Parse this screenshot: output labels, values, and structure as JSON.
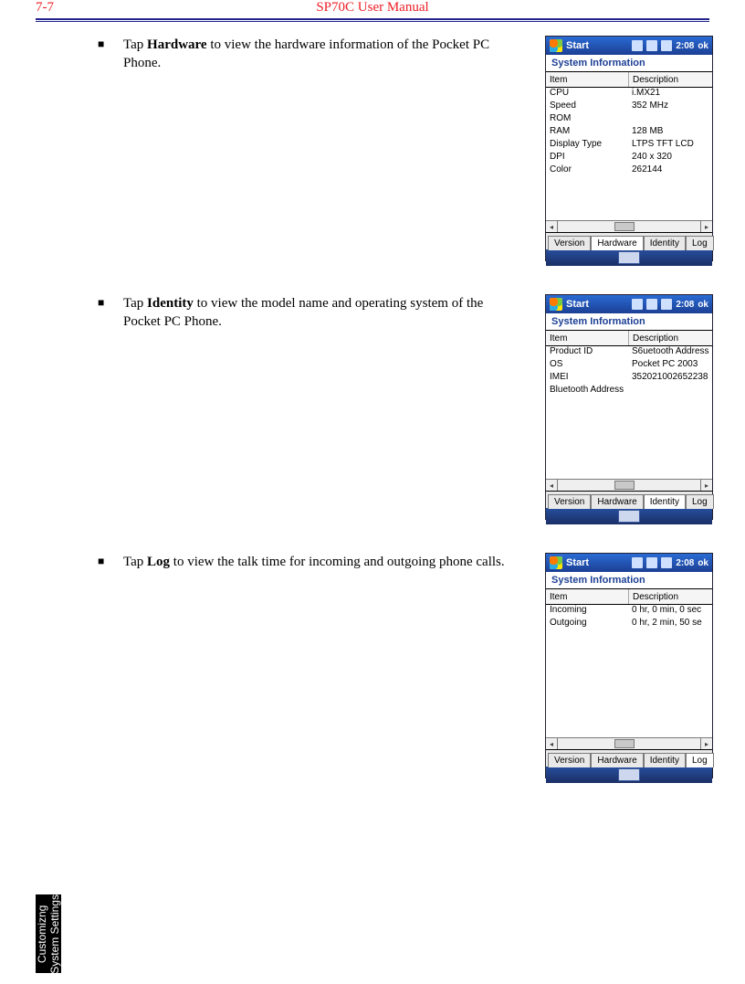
{
  "header": {
    "page_num": "7-7",
    "title": "SP70C User Manual"
  },
  "sidetab": {
    "line1": "Customizng",
    "line2": "System Settings"
  },
  "status_bar": {
    "start": "Start",
    "time": "2:08",
    "ok": "ok"
  },
  "window_title": "System Information",
  "columns": {
    "c1": "Item",
    "c2": "Description"
  },
  "tabs": [
    "Version",
    "Hardware",
    "Identity",
    "Log"
  ],
  "sections": [
    {
      "para_pre": "Tap ",
      "para_b": "Hardware",
      "para_post": " to view the hardware information of the Pocket PC Phone.",
      "active_tab": "Hardware",
      "rows": [
        {
          "c1": "CPU",
          "c2": "i.MX21"
        },
        {
          "c1": "Speed",
          "c2": "352 MHz"
        },
        {
          "c1": "ROM",
          "c2": ""
        },
        {
          "c1": "RAM",
          "c2": "128 MB"
        },
        {
          "c1": "Display Type",
          "c2": "LTPS TFT LCD"
        },
        {
          "c1": "DPI",
          "c2": "240 x 320"
        },
        {
          "c1": "Color",
          "c2": "262144"
        }
      ]
    },
    {
      "para_pre": "Tap ",
      "para_b": "Identity",
      "para_post": " to view the model name and operating system of the Pocket PC Phone.",
      "active_tab": "Identity",
      "rows": [
        {
          "c1": "Product ID",
          "c2": "S6uetooth Address"
        },
        {
          "c1": "OS",
          "c2": "Pocket PC 2003"
        },
        {
          "c1": "IMEI",
          "c2": "352021002652238"
        },
        {
          "c1": "Bluetooth Address",
          "c2": ""
        }
      ]
    },
    {
      "para_pre": "Tap ",
      "para_b": "Log",
      "para_post": " to view the talk time for incoming and outgoing phone calls.",
      "active_tab": "Log",
      "rows": [
        {
          "c1": "Incoming",
          "c2": "0 hr, 0 min, 0 sec"
        },
        {
          "c1": "Outgoing",
          "c2": "0 hr, 2 min, 50 se"
        }
      ]
    }
  ]
}
